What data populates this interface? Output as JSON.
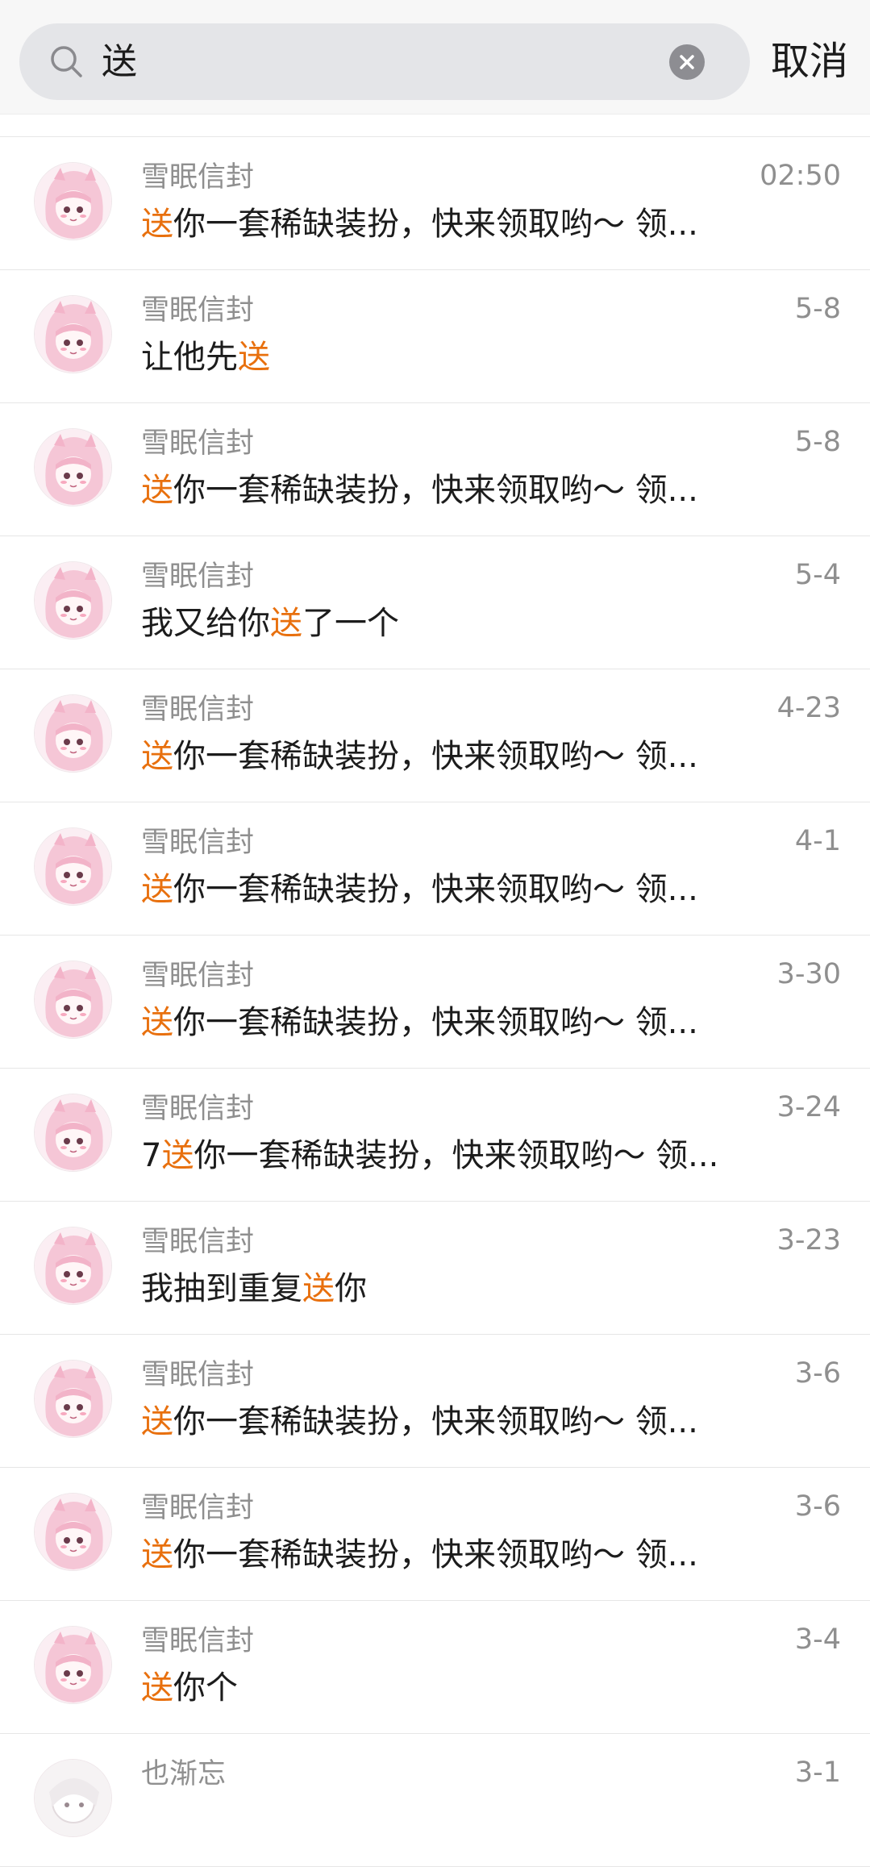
{
  "search": {
    "query": "送",
    "cancel_label": "取消"
  },
  "results": [
    {
      "sender": "雪眠信封",
      "pre": "",
      "match": "送",
      "post": "你一套稀缺装扮，快来领取哟～  领...",
      "time": "02:50",
      "avatar": "pink"
    },
    {
      "sender": "雪眠信封",
      "pre": "让他先",
      "match": "送",
      "post": "",
      "time": "5-8",
      "avatar": "pink"
    },
    {
      "sender": "雪眠信封",
      "pre": "",
      "match": "送",
      "post": "你一套稀缺装扮，快来领取哟～  领...",
      "time": "5-8",
      "avatar": "pink"
    },
    {
      "sender": "雪眠信封",
      "pre": "我又给你",
      "match": "送",
      "post": "了一个",
      "time": "5-4",
      "avatar": "pink"
    },
    {
      "sender": "雪眠信封",
      "pre": "",
      "match": "送",
      "post": "你一套稀缺装扮，快来领取哟～  领...",
      "time": "4-23",
      "avatar": "pink"
    },
    {
      "sender": "雪眠信封",
      "pre": "",
      "match": "送",
      "post": "你一套稀缺装扮，快来领取哟～  领...",
      "time": "4-1",
      "avatar": "pink"
    },
    {
      "sender": "雪眠信封",
      "pre": "",
      "match": "送",
      "post": "你一套稀缺装扮，快来领取哟～  领...",
      "time": "3-30",
      "avatar": "pink"
    },
    {
      "sender": "雪眠信封",
      "pre": "7",
      "match": "送",
      "post": "你一套稀缺装扮，快来领取哟～  领...",
      "time": "3-24",
      "avatar": "pink"
    },
    {
      "sender": "雪眠信封",
      "pre": "我抽到重复",
      "match": "送",
      "post": "你",
      "time": "3-23",
      "avatar": "pink"
    },
    {
      "sender": "雪眠信封",
      "pre": "",
      "match": "送",
      "post": "你一套稀缺装扮，快来领取哟～  领...",
      "time": "3-6",
      "avatar": "pink"
    },
    {
      "sender": "雪眠信封",
      "pre": "",
      "match": "送",
      "post": "你一套稀缺装扮，快来领取哟～  领...",
      "time": "3-6",
      "avatar": "pink"
    },
    {
      "sender": "雪眠信封",
      "pre": "",
      "match": "送",
      "post": "你个",
      "time": "3-4",
      "avatar": "pink"
    },
    {
      "sender": "也渐忘",
      "pre": "",
      "match": "",
      "post": "",
      "time": "3-1",
      "avatar": "white"
    }
  ],
  "colors": {
    "highlight": "#e8700e",
    "secondary_text": "#8f8f8f",
    "primary_text": "#1c1c1c",
    "search_box": "#e4e5e8"
  },
  "icons": {
    "search": "search-icon",
    "clear": "clear-icon"
  }
}
